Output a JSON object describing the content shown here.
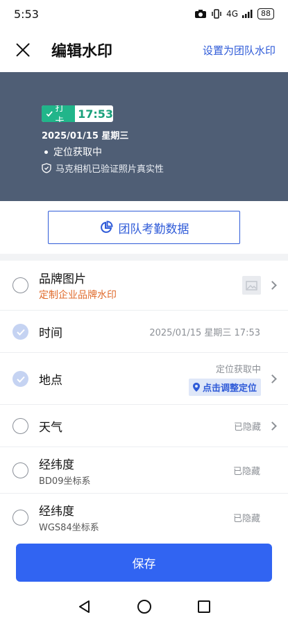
{
  "status_bar": {
    "time": "5:53",
    "network": "4G",
    "battery": "88"
  },
  "header": {
    "title": "编辑水印",
    "team_link": "设置为团队水印"
  },
  "preview": {
    "punch_label": "打卡",
    "punch_time": "17:53",
    "date_line": "2025/01/15  星期三",
    "location_text": "定位获取中",
    "verify_text": "马克相机已验证照片真实性"
  },
  "stats_button": {
    "label": "团队考勤数据"
  },
  "options": [
    {
      "label": "品牌图片",
      "sub": "定制企业品牌水印",
      "checked": false
    },
    {
      "label": "时间",
      "value": "2025/01/15 星期三 17:53",
      "checked": true
    },
    {
      "label": "地点",
      "value": "定位获取中",
      "action": "点击调整定位",
      "checked": true
    },
    {
      "label": "天气",
      "value": "已隐藏",
      "checked": false
    },
    {
      "label": "经纬度",
      "sub": "BD09坐标系",
      "value": "已隐藏",
      "checked": false
    },
    {
      "label": "经纬度",
      "sub": "WGS84坐标系",
      "value": "已隐藏",
      "checked": false
    }
  ],
  "save_button": {
    "label": "保存"
  },
  "colors": {
    "accent": "#3164f2",
    "preview_bg": "#4f5e75",
    "punch_green": "#21b58a",
    "brand_orange": "#e06b2c"
  },
  "icons": [
    "camera-icon",
    "vibrate-icon",
    "signal-icon",
    "battery-icon",
    "close-icon",
    "check-icon",
    "shield-icon",
    "pie-chart-icon",
    "image-icon",
    "location-pin-icon",
    "chevron-right-icon",
    "back-icon",
    "home-icon",
    "recents-icon"
  ]
}
